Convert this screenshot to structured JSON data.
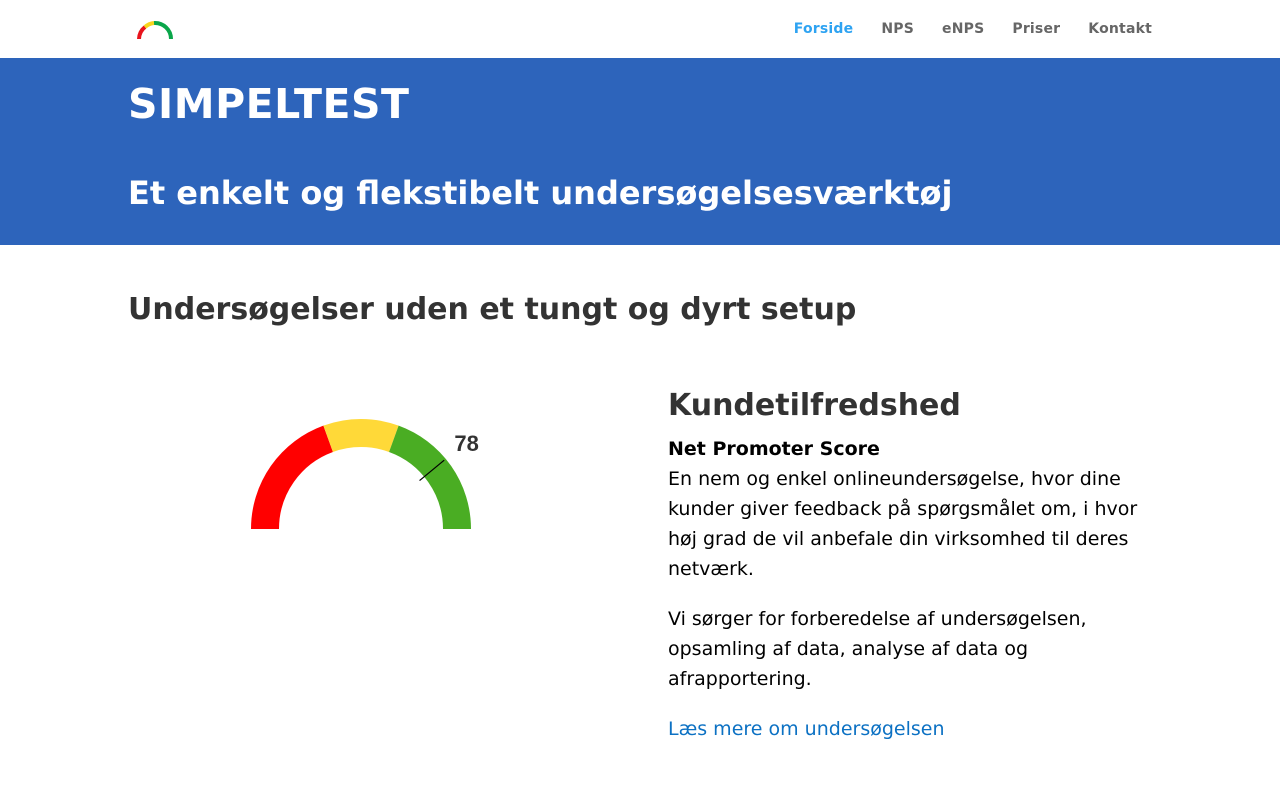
{
  "nav": {
    "items": [
      {
        "label": "Forside",
        "active": true
      },
      {
        "label": "NPS",
        "active": false
      },
      {
        "label": "eNPS",
        "active": false
      },
      {
        "label": "Priser",
        "active": false
      },
      {
        "label": "Kontakt",
        "active": false
      }
    ]
  },
  "hero": {
    "title": "SIMPELTEST",
    "subtitle": "Et enkelt og flekstibelt undersøgelsesværktøj"
  },
  "main": {
    "section_title": "Undersøgelser uden et tungt og dyrt setup"
  },
  "gauge": {
    "value_label": "78",
    "value": 78,
    "segments": [
      {
        "color": "#ff0000"
      },
      {
        "color": "#ffd938"
      },
      {
        "color": "#4aad23"
      }
    ]
  },
  "info": {
    "heading": "Kundetilfredshed",
    "subheading": "Net Promoter Score",
    "body1": "En nem og enkel onlineundersøgelse, hvor dine kunder giver feedback på spørgsmålet om, i hvor høj grad de vil anbefale din virksomhed til deres netværk.",
    "body2": "Vi sørger for forberedelse af undersøgelsen, opsamling af data, analyse af data og afrapportering.",
    "link": "Læs mere om undersøgelsen"
  },
  "colors": {
    "accent": "#2ea3f2",
    "hero_bg": "#2d64bb",
    "link": "#0c71c3"
  }
}
